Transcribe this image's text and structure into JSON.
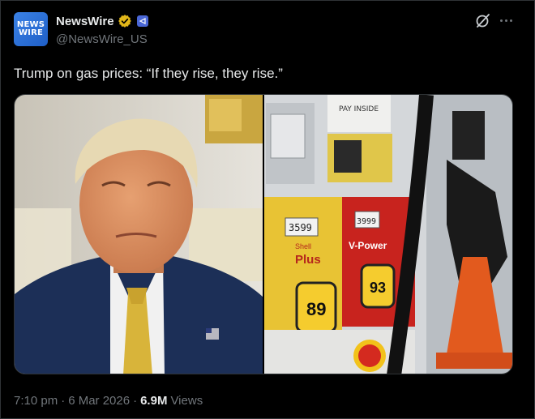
{
  "account": {
    "avatar_line1": "NEWS",
    "avatar_line2": "WIRE",
    "display_name": "NewsWire",
    "handle": "@NewsWire_US",
    "verified_icon": "gold-verified-badge-icon",
    "affiliate_icon": "affiliate-badge-icon"
  },
  "header_actions": {
    "grok_icon": "grok-icon",
    "more_icon": "more-options-icon"
  },
  "tweet": {
    "text": "Trump on gas prices: “If they rise, they rise.”"
  },
  "media": {
    "left_photo": "portrait-photo",
    "right_photo": "gas-pump-photo",
    "pump_price_left": "3599",
    "pump_price_right": "3999",
    "grade_plus_label": "Plus",
    "grade_plus_brand": "Shell",
    "grade_vpower_label": "V-Power",
    "octane_left": "89",
    "octane_right": "93",
    "handwritten_sign_1": "PAY INSIDE"
  },
  "meta": {
    "time": "7:10 pm",
    "separator": "·",
    "date": "6 Mar 2026",
    "separator2": "·",
    "views_count": "6.9M",
    "views_label": "Views"
  },
  "colors": {
    "background": "#000000",
    "text_primary": "#e7e9ea",
    "text_secondary": "#71767b",
    "avatar_blue": "#2f6fdc",
    "verified_gold": "#e2b719",
    "affiliate_blue": "#4a67d6"
  }
}
